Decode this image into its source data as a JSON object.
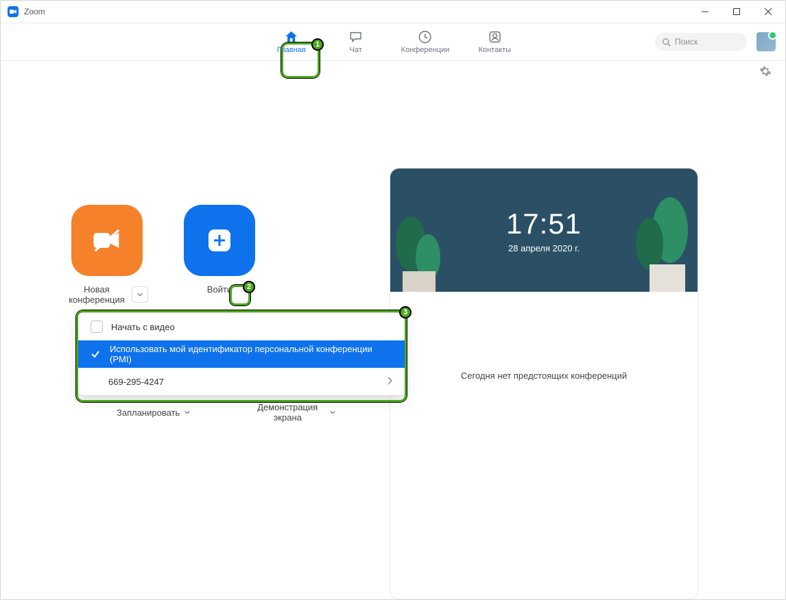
{
  "window": {
    "title": "Zoom"
  },
  "tabs": {
    "home": "Главная",
    "chat": "Чат",
    "conf": "Конференции",
    "contacts": "Контакты"
  },
  "search": {
    "placeholder": "Поиск"
  },
  "tiles": {
    "new_meeting": "Новая конференция",
    "join": "Войти",
    "schedule": "Запланировать",
    "share": "Демонстрация экрана"
  },
  "dropdown": {
    "start_video": "Начать с видео",
    "use_pmi": "Использовать мой идентификатор персональной конференции (PMI)",
    "pmi_number": "669-295-4247"
  },
  "card": {
    "time": "17:51",
    "date": "28 апреля 2020 г.",
    "no_meetings": "Сегодня нет предстоящих конференций"
  },
  "annotations": {
    "n1": "1",
    "n2": "2",
    "n3": "3"
  }
}
